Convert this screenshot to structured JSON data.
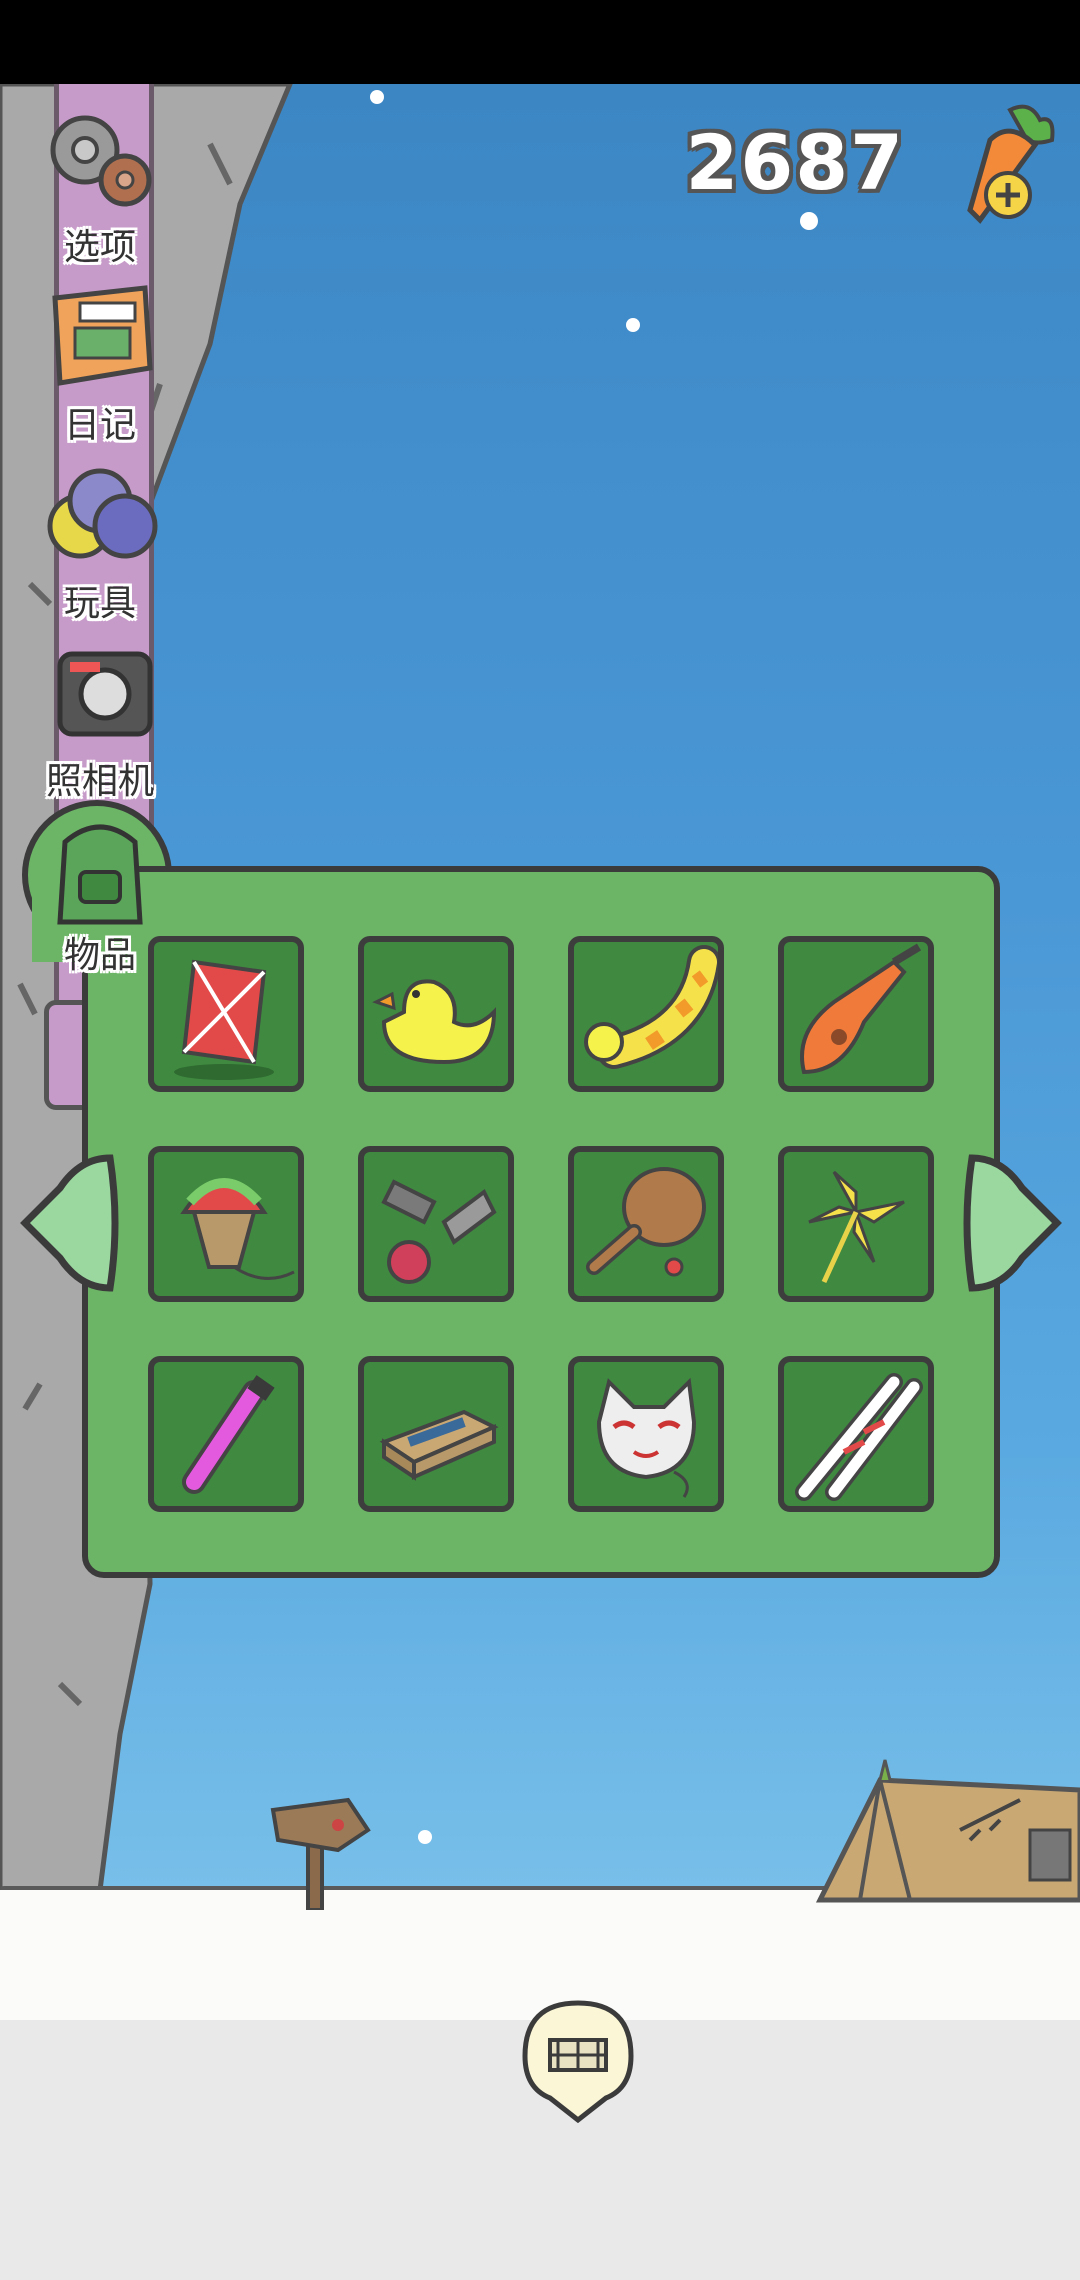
{
  "hud": {
    "carrot_count": "2687",
    "add_carrots_icon": "carrot-plus-icon"
  },
  "sidebar": {
    "items": [
      {
        "label": "选项",
        "icon": "gears-icon"
      },
      {
        "label": "日记",
        "icon": "diary-icon"
      },
      {
        "label": "玩具",
        "icon": "toy-balls-icon"
      },
      {
        "label": "照相机",
        "icon": "camera-icon"
      },
      {
        "label": "物品",
        "icon": "backpack-icon"
      }
    ]
  },
  "items_panel": {
    "items": [
      {
        "icon": "kite-icon"
      },
      {
        "icon": "rubber-duck-icon"
      },
      {
        "icon": "swim-ring-duck-icon"
      },
      {
        "icon": "guitar-icon"
      },
      {
        "icon": "straw-fan-icon"
      },
      {
        "icon": "kendama-icon"
      },
      {
        "icon": "paddle-ball-icon"
      },
      {
        "icon": "pinwheel-icon"
      },
      {
        "icon": "test-tube-icon"
      },
      {
        "icon": "matchbox-icon"
      },
      {
        "icon": "cat-mask-icon"
      },
      {
        "icon": "skis-icon"
      }
    ],
    "prev_icon": "arrow-left-icon",
    "next_icon": "arrow-right-icon"
  },
  "bottom": {
    "center_icon": "home-map-icon"
  },
  "colors": {
    "panel": "#6cb566",
    "slot": "#3f8a40",
    "sidebar_strip": "#c79bc9",
    "sky": "#4b98d6"
  }
}
